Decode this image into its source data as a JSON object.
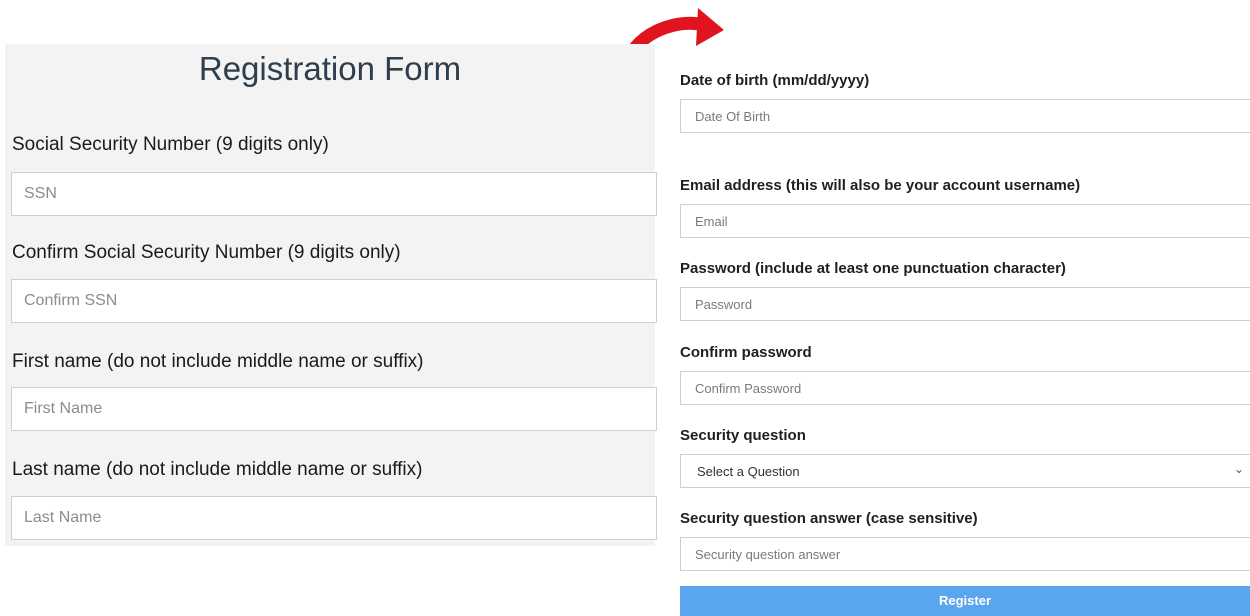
{
  "left_form": {
    "title": "Registration Form",
    "fields": [
      {
        "label": "Social Security Number (9 digits only)",
        "placeholder": "SSN"
      },
      {
        "label": "Confirm Social Security Number (9 digits only)",
        "placeholder": "Confirm SSN"
      },
      {
        "label": "First name (do not include middle name or suffix)",
        "placeholder": "First Name"
      },
      {
        "label": "Last name (do not include middle name or suffix)",
        "placeholder": "Last Name"
      }
    ]
  },
  "right_form": {
    "fields": [
      {
        "label": "Date of birth (mm/dd/yyyy)",
        "placeholder": "Date Of Birth"
      },
      {
        "label": "Email address (this will also be your account username)",
        "placeholder": "Email"
      },
      {
        "label": "Password (include at least one punctuation character)",
        "placeholder": "Password"
      },
      {
        "label": "Confirm password",
        "placeholder": "Confirm Password"
      }
    ],
    "security_question": {
      "label": "Security question",
      "selected": "Select a Question"
    },
    "security_answer": {
      "label": "Security question answer (case sensitive)",
      "placeholder": "Security question answer"
    },
    "register_label": "Register"
  },
  "colors": {
    "arrow": "#e0141e",
    "register_button": "#5aa6ee",
    "left_panel_bg": "#f3f3f3"
  },
  "icons": {
    "arrow": "curved-arrow-icon",
    "select_chevron": "chevron-down-icon"
  }
}
